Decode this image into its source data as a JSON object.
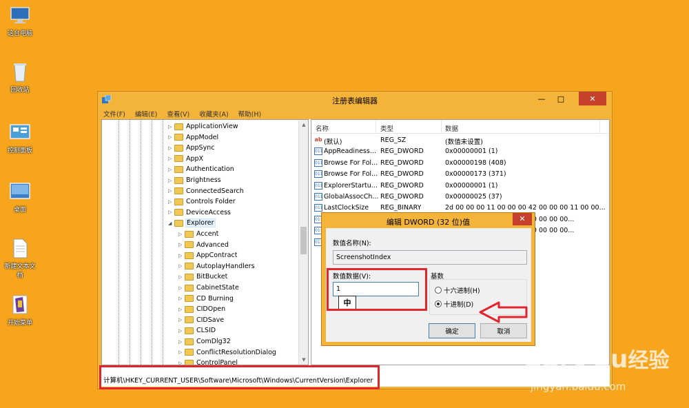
{
  "desktop": {
    "icons": [
      {
        "label": "这台电脑",
        "icon": "computer-icon"
      },
      {
        "label": "回收站",
        "icon": "recycle-bin-icon"
      },
      {
        "label": "控制面板",
        "icon": "control-panel-icon"
      },
      {
        "label": "桌面",
        "icon": "desktop-monitor-icon"
      },
      {
        "label": "新建文本文档",
        "icon": "text-document-icon"
      },
      {
        "label": "开始菜单",
        "icon": "start-menu-icon"
      }
    ]
  },
  "window": {
    "title": "注册表编辑器",
    "menu": [
      "文件(F)",
      "编辑(E)",
      "查看(V)",
      "收藏夹(A)",
      "帮助(H)"
    ],
    "tree": [
      {
        "label": "ApplicationView",
        "level": 1
      },
      {
        "label": "AppModel",
        "level": 1
      },
      {
        "label": "AppSync",
        "level": 1
      },
      {
        "label": "AppX",
        "level": 1
      },
      {
        "label": "Authentication",
        "level": 1
      },
      {
        "label": "Brightness",
        "level": 1
      },
      {
        "label": "ConnectedSearch",
        "level": 1
      },
      {
        "label": "Controls Folder",
        "level": 1
      },
      {
        "label": "DeviceAccess",
        "level": 1
      },
      {
        "label": "Explorer",
        "level": 1,
        "expanded": true,
        "selected": true
      },
      {
        "label": "Accent",
        "level": 2
      },
      {
        "label": "Advanced",
        "level": 2
      },
      {
        "label": "AppContract",
        "level": 2
      },
      {
        "label": "AutoplayHandlers",
        "level": 2
      },
      {
        "label": "BitBucket",
        "level": 2
      },
      {
        "label": "CabinetState",
        "level": 2
      },
      {
        "label": "CD Burning",
        "level": 2
      },
      {
        "label": "CIDOpen",
        "level": 2
      },
      {
        "label": "CIDSave",
        "level": 2
      },
      {
        "label": "CLSID",
        "level": 2
      },
      {
        "label": "ComDlg32",
        "level": 2
      },
      {
        "label": "ConflictResolutionDialog",
        "level": 2
      },
      {
        "label": "ControlPanel",
        "level": 2
      }
    ],
    "list": {
      "headers": [
        "名称",
        "类型",
        "数据"
      ],
      "rows": [
        {
          "icon": "ab",
          "name": "(默认)",
          "type": "REG_SZ",
          "data": "(数值未设置)"
        },
        {
          "icon": "dw",
          "name": "AppReadiness...",
          "type": "REG_DWORD",
          "data": "0x00000001 (1)"
        },
        {
          "icon": "dw",
          "name": "Browse For Fol...",
          "type": "REG_DWORD",
          "data": "0x00000198 (408)"
        },
        {
          "icon": "dw",
          "name": "Browse For Fol...",
          "type": "REG_DWORD",
          "data": "0x00000173 (371)"
        },
        {
          "icon": "dw",
          "name": "ExplorerStartu...",
          "type": "REG_DWORD",
          "data": "0x00000001 (1)"
        },
        {
          "icon": "dw",
          "name": "GlobalAssocCh...",
          "type": "REG_DWORD",
          "data": "0x00000025 (37)"
        },
        {
          "icon": "dw",
          "name": "LastClockSize",
          "type": "REG_BINARY",
          "data": "2d 00 00 00 11 00 00 00 42 00 00 00 11 00 00..."
        },
        {
          "icon": "dw",
          "name": "",
          "type": "",
          "data": "00 00 00 00 00 00 00 00 00 00 00 00..."
        },
        {
          "icon": "dw",
          "name": "",
          "type": "",
          "data": "00 00 00 00 00 00 00 00 00 00 00 00..."
        },
        {
          "icon": "dw",
          "name": "",
          "type": "",
          "data": ""
        }
      ]
    },
    "status_path": "计算机\\HKEY_CURRENT_USER\\Software\\Microsoft\\Windows\\CurrentVersion\\Explorer"
  },
  "dialog": {
    "title": "编辑 DWORD (32 位)值",
    "name_label": "数值名称(N):",
    "name_value": "ScreenshotIndex",
    "data_label": "数值数据(V):",
    "data_value": "1",
    "base_label": "基数",
    "radio_hex": "十六进制(H)",
    "radio_dec": "十进制(D)",
    "selected_base": "dec",
    "ok": "确定",
    "cancel": "取消",
    "ime": "中",
    "close_glyph": "✕"
  },
  "watermark": {
    "brand": "Bai",
    "brand2": "du",
    "brand_cn": "经验",
    "url": "jingyan.baidu.com"
  },
  "colors": {
    "desktop": "#f6a51c",
    "annotation": "#e0252c",
    "window_frame": "#f4b43a"
  }
}
